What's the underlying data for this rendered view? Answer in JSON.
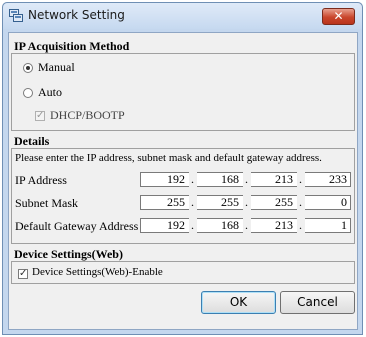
{
  "window": {
    "title": "Network Setting",
    "close_symbol": "✕",
    "app_icon": "network-settings-icon"
  },
  "ip_acquisition": {
    "heading": "IP Acquisition Method",
    "manual_label": "Manual",
    "manual_selected": true,
    "auto_label": "Auto",
    "auto_selected": false,
    "dhcp_label": "DHCP/BOOTP",
    "dhcp_checked": true,
    "dhcp_enabled": false
  },
  "details": {
    "heading": "Details",
    "instruction": "Please enter the IP address, subnet mask and default gateway address.",
    "fields": [
      {
        "label": "IP Address",
        "octets": [
          "192",
          "168",
          "213",
          "233"
        ]
      },
      {
        "label": "Subnet Mask",
        "octets": [
          "255",
          "255",
          "255",
          "0"
        ]
      },
      {
        "label": "Default Gateway Address",
        "octets": [
          "192",
          "168",
          "213",
          "1"
        ]
      }
    ]
  },
  "device_settings": {
    "heading": "Device Settings(Web)",
    "enable_label": "Device Settings(Web)-Enable",
    "enable_checked": true
  },
  "buttons": {
    "ok_label": "OK",
    "cancel_label": "Cancel"
  }
}
